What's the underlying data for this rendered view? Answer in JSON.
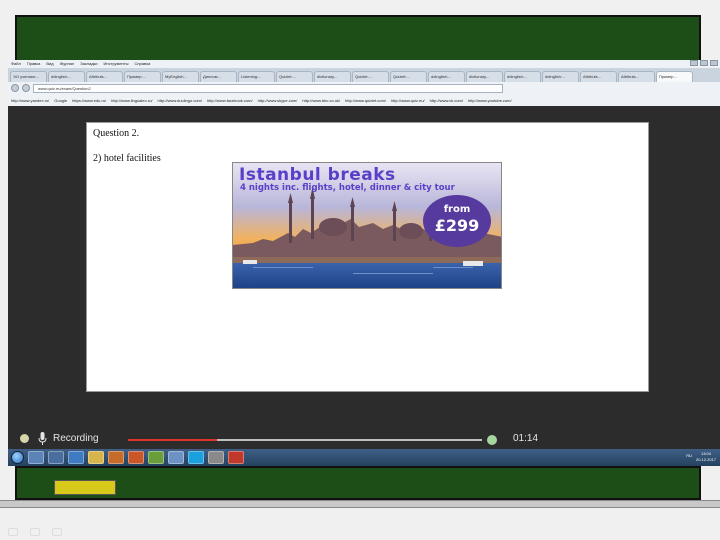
{
  "browser": {
    "menu": [
      "Файл",
      "Правка",
      "Вид",
      "Журнал",
      "Закладки",
      "Инструменты",
      "Справка"
    ],
    "tabs": [
      "ЭО ученики:...",
      "ddinglish:...",
      "Attributs...",
      "Пример:...",
      "MyEnglish...",
      "Диплом...",
      "Listening:...",
      "Quizlet:...",
      "dictionary...",
      "Quizlet:...",
      "Quizlet:...",
      "ddinglish:...",
      "dictionary...",
      "ddinglish:...",
      "ddinglish:...",
      "Attributs...",
      "Attributs...",
      "Пример..."
    ],
    "active_tab_index": 17,
    "url": "www.quiz.eu/exam/Question2",
    "bookmarks": [
      "http://www.yandex.ru/",
      "Google",
      "https://www.edu.ru/",
      "http://www.lingualeo.ru/",
      "http://www.duolingo.com/",
      "http://www.facebook.com/",
      "http://www.skype.com/",
      "http://www.bbc.co.uk/",
      "http://www.quizlet.com/",
      "http://www.quiz.eu/",
      "http://www.vk.com/",
      "http://www.youtube.com/"
    ]
  },
  "document": {
    "question_title": "Question 2.",
    "question_item": "2) hotel facilities"
  },
  "advert": {
    "title": "Istanbul breaks",
    "subtitle": "4 nights inc. flights, hotel, dinner & city tour",
    "price_from": "from",
    "price": "£299",
    "colors": {
      "text": "#5b3fc9",
      "badge": "#563a9e",
      "sky_top": "#4f6fb0",
      "sky_glow": "#f0a94a",
      "water": "#2d59a8"
    }
  },
  "recorder": {
    "label": "Recording",
    "time": "01:14",
    "progress_fraction": 0.25,
    "colors": {
      "progress": "#e0332d",
      "track": "#bfbfbf"
    }
  },
  "taskbar": {
    "clock_time": "13:04",
    "clock_date": "20.12.2017",
    "tray_text": "RU"
  },
  "icons": [
    "start-orb-icon",
    "mic-icon",
    "record-dot-icon",
    "back-icon",
    "forward-icon"
  ]
}
